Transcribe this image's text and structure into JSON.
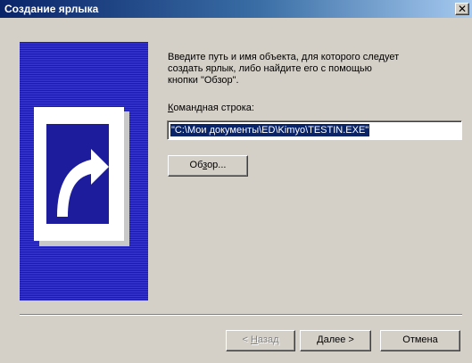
{
  "window": {
    "title": "Создание ярлыка",
    "close_glyph": "✕"
  },
  "banner": {
    "icon": "shortcut-arrow-icon"
  },
  "instructions": {
    "text": "Введите путь и имя объекта, для которого следует\nсоздать ярлык, либо найдите его с помощью\nкнопки \"Обзор\"."
  },
  "command_line": {
    "label_prefix": "",
    "label_mnemonic": "К",
    "label_rest": "омандная строка:",
    "value": "\"C:\\Мои документы\\ED\\Kimyo\\TESTIN.EXE\""
  },
  "buttons": {
    "browse_pre": "Об",
    "browse_mn": "з",
    "browse_post": "ор...",
    "back_pre": "< ",
    "back_mn": "Н",
    "back_post": "азад",
    "next_label": "Далее >",
    "cancel_label": "Отмена"
  },
  "colors": {
    "titlebar_start": "#0a246a",
    "titlebar_end": "#a6caf0",
    "selection": "#0a246a",
    "banner_dark": "#1c1c9c",
    "banner_light": "#3a3ad2"
  }
}
